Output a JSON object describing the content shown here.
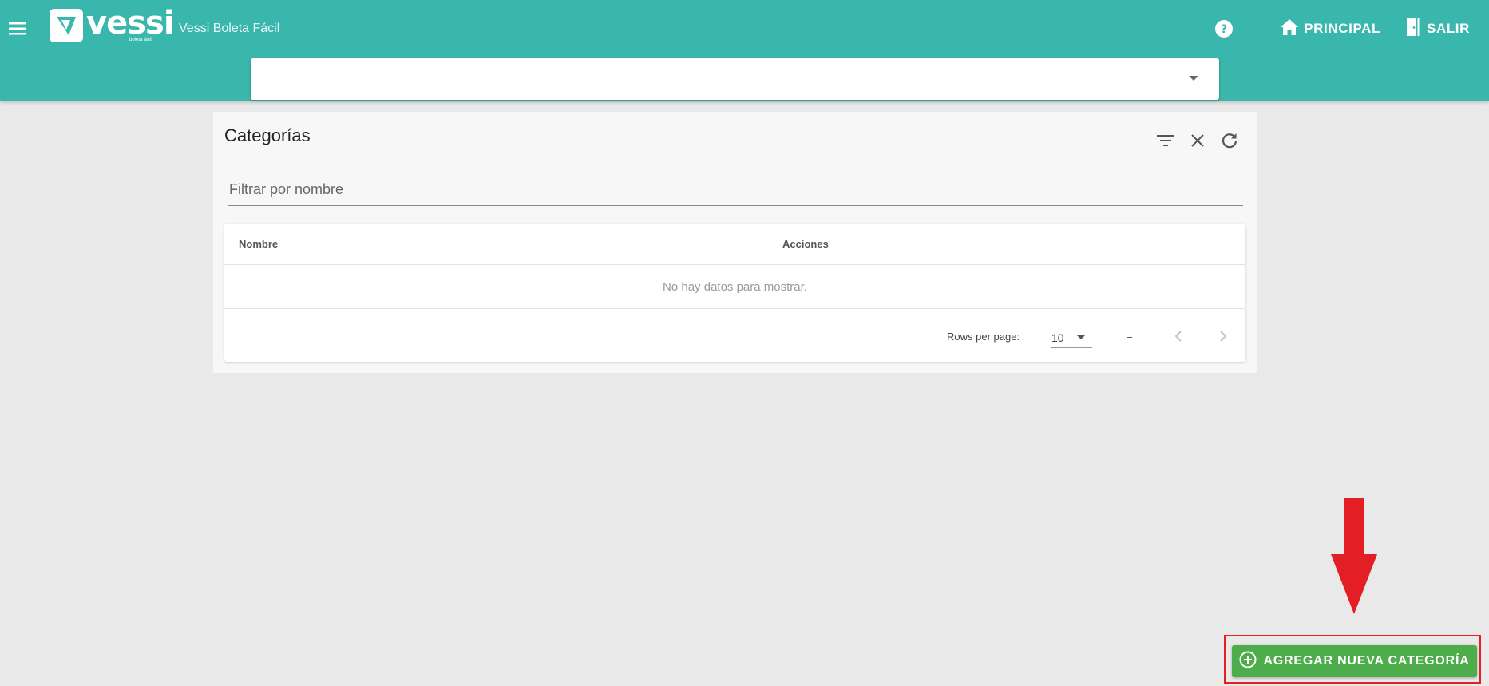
{
  "header": {
    "logo_text": "vessi",
    "logo_subtext": "boleta fácil",
    "app_title": "Vessi Boleta Fácil",
    "nav": [
      {
        "label": "PRINCIPAL",
        "icon": "home-icon"
      },
      {
        "label": "SALIR",
        "icon": "exit-door-icon"
      }
    ],
    "help_icon": "help-circle-icon",
    "menu_icon": "hamburger-menu-icon"
  },
  "selector": {
    "value": ""
  },
  "card": {
    "title": "Categorías",
    "icons": [
      "filter-icon",
      "close-icon",
      "refresh-icon"
    ],
    "filter_placeholder": "Filtrar por nombre",
    "table": {
      "columns": [
        "Nombre",
        "Acciones"
      ],
      "rows": [],
      "empty_message": "No hay datos para mostrar."
    },
    "pagination": {
      "rows_per_page_label": "Rows per page:",
      "rows_per_page": "10",
      "range": "–"
    }
  },
  "add_button": {
    "label": "AGREGAR NUEVA CATEGORÍA",
    "icon": "plus-circle-icon"
  },
  "colors": {
    "header": "#3ab7ad",
    "add_button": "#4cad4a",
    "annotation": "#e02222"
  }
}
